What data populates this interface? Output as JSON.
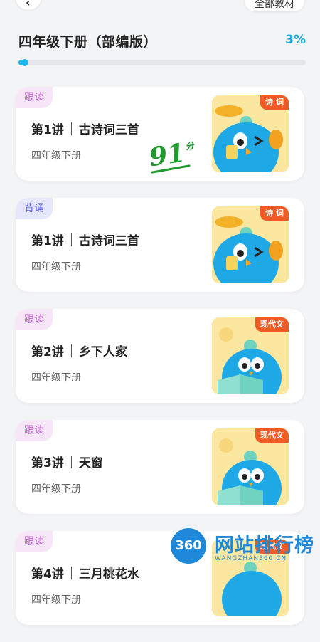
{
  "header": {
    "back_icon": "chevron-left-icon",
    "back_glyph": "‹",
    "all_materials_label": "全部教材"
  },
  "book": {
    "title": "四年级下册（部编版）",
    "progress_label": "3%",
    "progress_value": 0.03
  },
  "colors": {
    "accent": "#23b4ea",
    "tag_read_bg": "#f6e6f8",
    "tag_recite_bg": "#e6e7fb",
    "ribbon": "#f05a24",
    "score": "#1f9a2d"
  },
  "lessons": [
    {
      "mode": "跟读",
      "number": "第1讲",
      "title": "古诗词三首",
      "grade": "四年级下册",
      "category": "诗 词",
      "score": "91",
      "score_unit": "分"
    },
    {
      "mode": "背诵",
      "number": "第1讲",
      "title": "古诗词三首",
      "grade": "四年级下册",
      "category": "诗 词"
    },
    {
      "mode": "跟读",
      "number": "第2讲",
      "title": "乡下人家",
      "grade": "四年级下册",
      "category": "现代文"
    },
    {
      "mode": "跟读",
      "number": "第3讲",
      "title": "天窗",
      "grade": "四年级下册",
      "category": "现代文"
    },
    {
      "mode": "跟读",
      "number": "第4讲",
      "title": "三月桃花水",
      "grade": "四年级下册",
      "category": "现代文"
    }
  ],
  "watermark": {
    "badge": "360",
    "title": "网站排行榜",
    "url": "WANGZHAN360.CN"
  }
}
